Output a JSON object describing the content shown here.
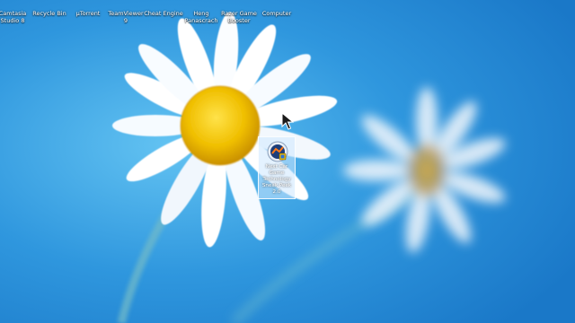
{
  "desktop": {
    "top_icons": [
      {
        "label": "Camtasia\nStudio 8"
      },
      {
        "label": "Recycle Bin"
      },
      {
        "label": "µTorrent"
      },
      {
        "label": "TeamViewer\n9"
      },
      {
        "label": "Cheat Engine"
      },
      {
        "label": "Heng\nPanascrach"
      },
      {
        "label": "Razer Game\nBooster"
      },
      {
        "label": "Computer"
      }
    ],
    "selected_icon": {
      "label": "Next Car\nGame\nTechnology\nSneak Peek\n2.0",
      "icon": "game-app-icon"
    },
    "colors": {
      "sky": "#2e95dd",
      "petal": "#ffffff",
      "center": "#f2c200",
      "selection": "#cde8ff"
    }
  }
}
